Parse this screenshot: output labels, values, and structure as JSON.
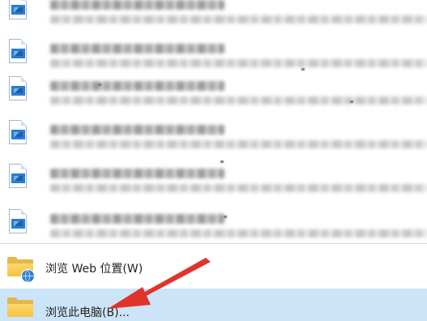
{
  "recent_documents": {
    "count_visible": 6,
    "items": [
      {
        "icon": "word-document-icon"
      },
      {
        "icon": "word-document-icon"
      },
      {
        "icon": "word-document-icon"
      },
      {
        "icon": "word-document-icon"
      },
      {
        "icon": "word-document-icon"
      },
      {
        "icon": "word-document-icon"
      }
    ]
  },
  "actions": {
    "browse_web": {
      "label": "浏览 Web 位置(W)",
      "icon": "folder-globe-icon"
    },
    "browse_pc": {
      "label": "浏览此电脑(B)...",
      "icon": "folder-icon"
    }
  },
  "colors": {
    "highlight": "#cce4f7",
    "folder": "#f5c244",
    "word_blue": "#2b7cd3",
    "annotation_arrow": "#e0342b"
  }
}
